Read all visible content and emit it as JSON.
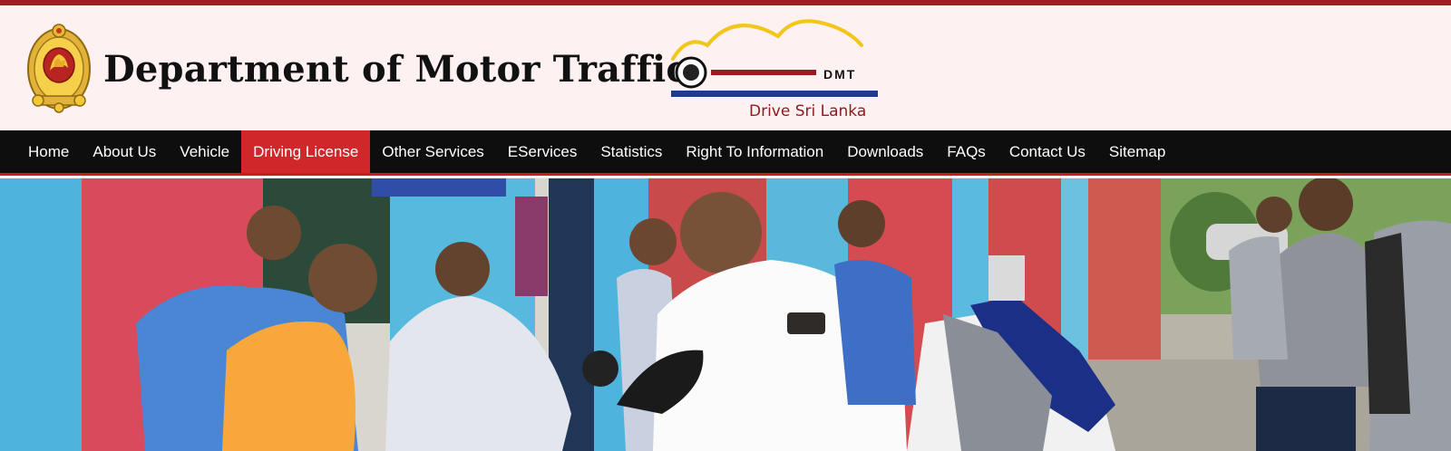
{
  "header": {
    "title": "Department of Motor Traffic",
    "logo": {
      "abbr": "DMT",
      "tagline": "Drive Sri Lanka"
    },
    "emblem_icon": "sri-lanka-emblem-icon"
  },
  "nav": {
    "items": [
      {
        "label": "Home",
        "active": false
      },
      {
        "label": "About Us",
        "active": false
      },
      {
        "label": "Vehicle",
        "active": false
      },
      {
        "label": "Driving License",
        "active": true
      },
      {
        "label": "Other Services",
        "active": false
      },
      {
        "label": "EServices",
        "active": false
      },
      {
        "label": "Statistics",
        "active": false
      },
      {
        "label": "Right To Information",
        "active": false
      },
      {
        "label": "Downloads",
        "active": false
      },
      {
        "label": "FAQs",
        "active": false
      },
      {
        "label": "Contact Us",
        "active": false
      },
      {
        "label": "Sitemap",
        "active": false
      }
    ]
  },
  "colors": {
    "accent": "#d0272b",
    "top_strip": "#a31d22",
    "nav_bg": "#0e0e0e",
    "header_bg": "#fdf1f1",
    "logo_arc": "#f2c61a",
    "logo_bar_red": "#9a1c22",
    "logo_bar_blue": "#1e3c8c"
  }
}
